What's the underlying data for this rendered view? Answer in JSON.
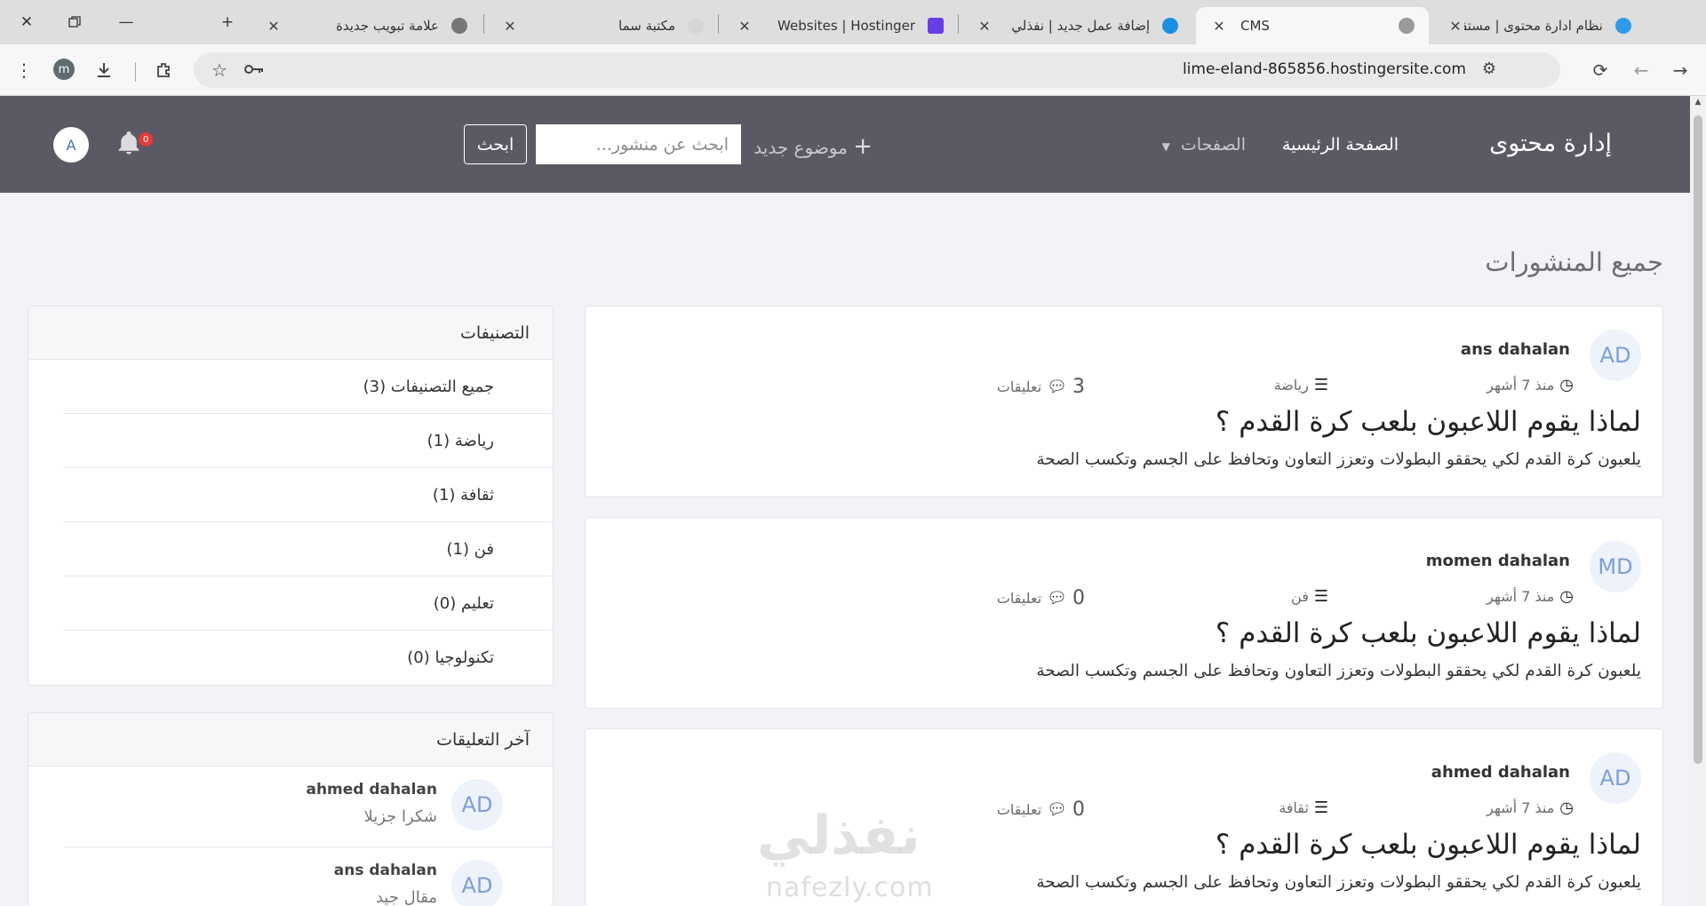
{
  "browser": {
    "tabs": [
      {
        "title": "نظام ادارة محتوى | مستقل",
        "favicon_color": "#2f9be8"
      },
      {
        "title": "CMS",
        "favicon_color": "#8a8a8a"
      },
      {
        "title": "إضافة عمل جديد | نفذلي",
        "favicon_color": "#1d8fe0"
      },
      {
        "title": "Websites | Hostinger",
        "favicon_color": "#673de6"
      },
      {
        "title": "مكتبة سما",
        "favicon_color": "#cccccc"
      },
      {
        "title": "علامة تبويب جديدة",
        "favicon_color": "#777777"
      }
    ],
    "url": "lime-eland-865856.hostingersite.com",
    "profile_initial": "m"
  },
  "navbar": {
    "brand": "إدارة محتوى",
    "home": "الصفحة الرئيسية",
    "pages": "الصفحات",
    "new_post": "موضوع جديد",
    "search_placeholder": "ابحث عن منشور...",
    "search_button": "ابحث",
    "notifications_count": "0",
    "user_initial": "A"
  },
  "page_title": "جميع المنشورات",
  "posts": [
    {
      "initials": "AD",
      "author": "ans dahalan",
      "time": "منذ 7 أشهر",
      "category": "رياضة",
      "comment_count": "3",
      "comments_label": "تعليقات",
      "title": "لماذا يقوم اللاعبون بلعب كرة القدم ؟",
      "excerpt": "يلعبون كرة القدم لكي يحققو البطولات وتعزز التعاون وتحافظ على الجسم وتكسب الصحة"
    },
    {
      "initials": "MD",
      "author": "momen dahalan",
      "time": "منذ 7 أشهر",
      "category": "فن",
      "comment_count": "0",
      "comments_label": "تعليقات",
      "title": "لماذا يقوم اللاعبون بلعب كرة القدم ؟",
      "excerpt": "يلعبون كرة القدم لكي يحققو البطولات وتعزز التعاون وتحافظ على الجسم وتكسب الصحة"
    },
    {
      "initials": "AD",
      "author": "ahmed dahalan",
      "time": "منذ 7 أشهر",
      "category": "ثقافة",
      "comment_count": "0",
      "comments_label": "تعليقات",
      "title": "لماذا يقوم اللاعبون بلعب كرة القدم ؟",
      "excerpt": "يلعبون كرة القدم لكي يحققو البطولات وتعزز التعاون وتحافظ على الجسم وتكسب الصحة"
    }
  ],
  "sidebar": {
    "categories_title": "التصنيفات",
    "categories": [
      "جميع التصنيفات (3)",
      "رياضة (1)",
      "ثقافة (1)",
      "فن (1)",
      "تعليم (0)",
      "تكنولوجيا (0)"
    ],
    "comments_title": "آخر التعليقات",
    "comments": [
      {
        "initials": "AD",
        "name": "ahmed dahalan",
        "text": "شكرا جزيلا"
      },
      {
        "initials": "AD",
        "name": "ans dahalan",
        "text": "مقال جيد"
      }
    ]
  },
  "watermark": {
    "text": "نفذلي",
    "sub": "nafezly.com"
  }
}
